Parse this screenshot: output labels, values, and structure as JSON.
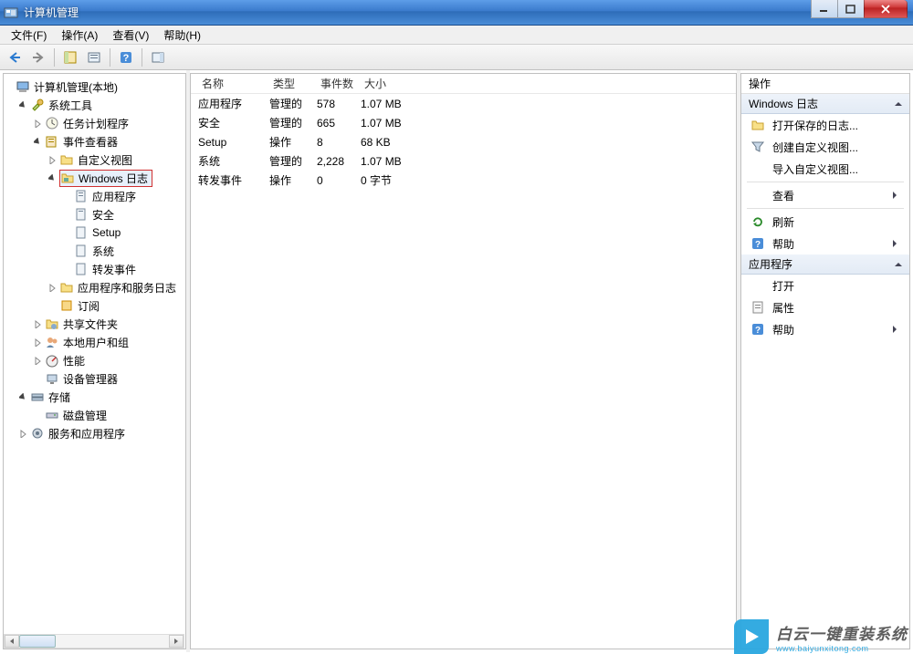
{
  "window": {
    "title": "计算机管理"
  },
  "menu": {
    "file": "文件(F)",
    "action": "操作(A)",
    "view": "查看(V)",
    "help": "帮助(H)"
  },
  "tree": {
    "root": "计算机管理(本地)",
    "system_tools": "系统工具",
    "task_scheduler": "任务计划程序",
    "event_viewer": "事件查看器",
    "custom_views": "自定义视图",
    "windows_logs": "Windows 日志",
    "application": "应用程序",
    "security": "安全",
    "setup": "Setup",
    "system": "系统",
    "forwarded": "转发事件",
    "app_service_logs": "应用程序和服务日志",
    "subscriptions": "订阅",
    "shared_folders": "共享文件夹",
    "local_users": "本地用户和组",
    "performance": "性能",
    "device_manager": "设备管理器",
    "storage": "存储",
    "disk_mgmt": "磁盘管理",
    "services_apps": "服务和应用程序"
  },
  "list": {
    "headers": {
      "name": "名称",
      "type": "类型",
      "count": "事件数",
      "size": "大小"
    },
    "rows": [
      {
        "name": "应用程序",
        "type": "管理的",
        "count": "578",
        "size": "1.07 MB"
      },
      {
        "name": "安全",
        "type": "管理的",
        "count": "665",
        "size": "1.07 MB"
      },
      {
        "name": "Setup",
        "type": "操作",
        "count": "8",
        "size": "68 KB"
      },
      {
        "name": "系统",
        "type": "管理的",
        "count": "2,228",
        "size": "1.07 MB"
      },
      {
        "name": "转发事件",
        "type": "操作",
        "count": "0",
        "size": "0 字节"
      }
    ]
  },
  "actions": {
    "header": "操作",
    "section1": "Windows 日志",
    "open_saved": "打开保存的日志...",
    "create_custom": "创建自定义视图...",
    "import_custom": "导入自定义视图...",
    "view": "查看",
    "refresh": "刷新",
    "help": "帮助",
    "section2": "应用程序",
    "open": "打开",
    "properties": "属性",
    "help2": "帮助"
  },
  "watermark": {
    "line1": "白云一键重装系统",
    "line2": "www.baiyunxitong.com"
  }
}
